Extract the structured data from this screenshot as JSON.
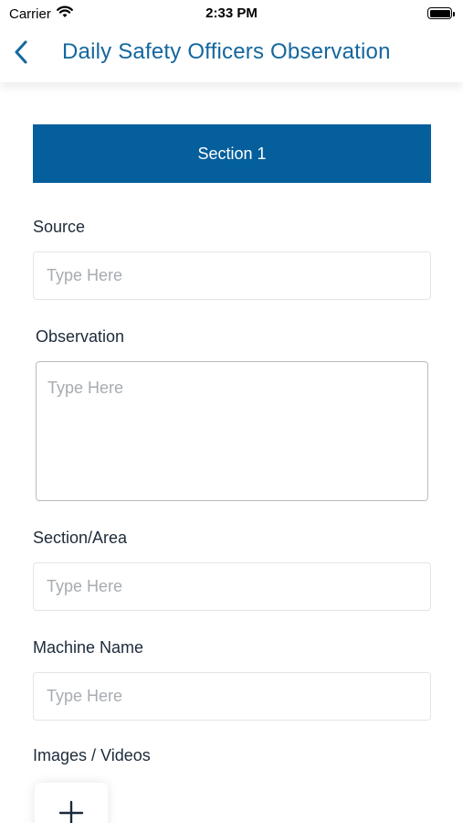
{
  "status_bar": {
    "carrier": "Carrier",
    "time": "2:33 PM",
    "wifi_icon": "wifi-icon",
    "battery_icon": "battery-icon"
  },
  "nav": {
    "back_icon": "chevron-left-icon",
    "title": "Daily Safety Officers Observation"
  },
  "form": {
    "section_title": "Section 1",
    "source": {
      "label": "Source",
      "placeholder": "Type Here"
    },
    "observation": {
      "label": "Observation",
      "placeholder": "Type Here"
    },
    "section_area": {
      "label": "Section/Area",
      "placeholder": "Type Here"
    },
    "machine_name": {
      "label": "Machine Name",
      "placeholder": "Type Here"
    },
    "media": {
      "label": "Images / Videos",
      "add_icon": "plus-icon"
    }
  },
  "colors": {
    "accent": "#045f9c",
    "title": "#14679e",
    "label": "#1c2b3a",
    "placeholder": "#a7acb1"
  }
}
